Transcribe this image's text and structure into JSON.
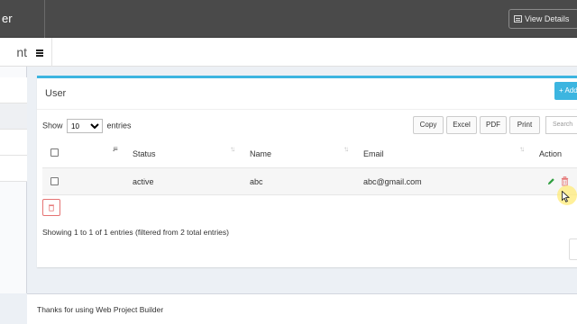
{
  "topbar": {
    "brand_fragment": "er",
    "view_details_label": "View Details"
  },
  "sidebar": {
    "brand_fragment": "nt"
  },
  "box": {
    "title": "User",
    "add_label": "+ Add"
  },
  "controls": {
    "show_label": "Show",
    "entries_value": "10",
    "entries_label": "entries",
    "export_buttons": [
      "Copy",
      "Excel",
      "PDF",
      "Print"
    ],
    "search_placeholder": "Search"
  },
  "table": {
    "headers": [
      "",
      "",
      "Status",
      "Name",
      "Email",
      "Action"
    ],
    "rows": [
      {
        "status": "active",
        "name": "abc",
        "email": "abc@gmail.com"
      }
    ]
  },
  "info_text": "Showing 1 to 1 of 1 entries (filtered from 2 total entries)",
  "footer_text": "Thanks for using Web Project Builder",
  "colors": {
    "topbar": "#4a4a4a",
    "accent": "#3cb5e0",
    "edit": "#2e9e3e",
    "delete": "#e57373"
  }
}
